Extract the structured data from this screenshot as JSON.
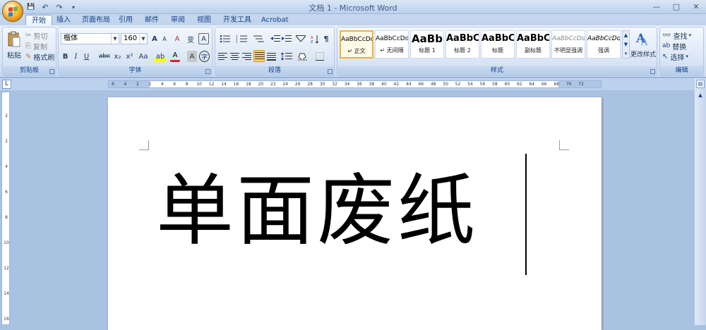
{
  "title_bar": {
    "title": "文档 1 - Microsoft Word"
  },
  "quick_access": [
    {
      "icon": "save-icon",
      "glyph": "💾"
    },
    {
      "icon": "undo-icon",
      "glyph": "↶"
    },
    {
      "icon": "redo-icon",
      "glyph": "↷"
    },
    {
      "icon": "customize-qat-icon",
      "glyph": "▾"
    }
  ],
  "window_controls": {
    "minimize": "—",
    "maximize": "□",
    "close": "✕"
  },
  "tabs": [
    "开始",
    "插入",
    "页面布局",
    "引用",
    "邮件",
    "审阅",
    "视图",
    "开发工具",
    "Acrobat"
  ],
  "active_tab": "开始",
  "clipboard": {
    "group_label": "剪贴板",
    "paste": "粘贴",
    "cut": "剪切",
    "copy": "复制",
    "format_painter": "格式刷"
  },
  "font": {
    "group_label": "字体",
    "font_name": "楷体",
    "font_size": "160",
    "grow": "A",
    "shrink": "A",
    "clear": "A",
    "phonetic": "变",
    "border_char": "A",
    "bold": "B",
    "italic": "I",
    "underline": "U",
    "strike": "abc",
    "subscript": "x₂",
    "superscript": "x²",
    "change_case": "Aa",
    "highlight": "ab",
    "font_color": "A",
    "char_shading": "A",
    "enclosed": "字"
  },
  "paragraph": {
    "group_label": "段落"
  },
  "styles": {
    "group_label": "样式",
    "items": [
      {
        "preview": "AaBbCcDd",
        "name": "↵ 正文"
      },
      {
        "preview": "AaBbCcDd",
        "name": "↵ 无间隔"
      },
      {
        "preview": "AaBb",
        "name": "标题 1"
      },
      {
        "preview": "AaBbC",
        "name": "标题 2"
      },
      {
        "preview": "AaBbC",
        "name": "标题"
      },
      {
        "preview": "AaBbC",
        "name": "副标题"
      },
      {
        "preview": "AaBbCcDd",
        "name": "不明显强调"
      },
      {
        "preview": "AaBbCcDd",
        "name": "强调"
      }
    ],
    "change_styles": "更改样式"
  },
  "editing": {
    "group_label": "编辑",
    "find": "查找",
    "replace": "替换",
    "select": "选择"
  },
  "ruler": {
    "ticks": [
      "6",
      "4",
      "2",
      "2",
      "4",
      "6",
      "8",
      "10",
      "12",
      "14",
      "16",
      "18",
      "20",
      "22",
      "24",
      "26",
      "28",
      "30",
      "32",
      "34",
      "36",
      "38",
      "40",
      "42",
      "44",
      "46",
      "48",
      "50",
      "52",
      "54",
      "56",
      "58",
      "60",
      "62",
      "64",
      "66",
      "68",
      "70",
      "72"
    ],
    "vticks": [
      "2",
      "2",
      "4",
      "6",
      "8",
      "10",
      "12",
      "14",
      "16"
    ]
  },
  "document": {
    "text": "单面废纸"
  },
  "colors": {
    "ribbon_bg": "#dbe6f5",
    "tab_text": "#15428b",
    "workspace": "#a9c2e2",
    "selected_style_border": "#f0b040"
  }
}
